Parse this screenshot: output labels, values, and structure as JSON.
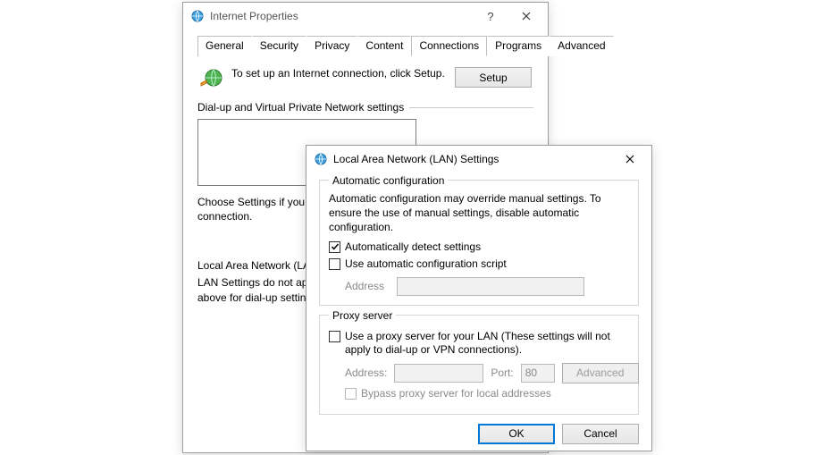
{
  "parent": {
    "title": "Internet Properties",
    "tabs": [
      "General",
      "Security",
      "Privacy",
      "Content",
      "Connections",
      "Programs",
      "Advanced"
    ],
    "active_tab_index": 4,
    "setup_text": "To set up an Internet connection, click Setup.",
    "setup_button": "Setup",
    "dialup_heading": "Dial-up and Virtual Private Network settings",
    "choose_text": "Choose Settings if you need to configure a proxy server for a connection.",
    "lan_heading": "Local Area Network (LAN) settings",
    "lan_text": "LAN Settings do not apply to dial-up connections. Choose Settings above for dial-up settings."
  },
  "lan": {
    "title": "Local Area Network (LAN) Settings",
    "auto": {
      "legend": "Automatic configuration",
      "desc": "Automatic configuration may override manual settings.  To ensure the use of manual settings, disable automatic configuration.",
      "detect_label": "Automatically detect settings",
      "detect_checked": true,
      "script_label": "Use automatic configuration script",
      "script_checked": false,
      "address_label": "Address",
      "address_value": ""
    },
    "proxy": {
      "legend": "Proxy server",
      "use_label": "Use a proxy server for your LAN (These settings will not apply to dial-up or VPN connections).",
      "use_checked": false,
      "address_label": "Address:",
      "address_value": "",
      "port_label": "Port:",
      "port_value": "80",
      "advanced_button": "Advanced",
      "bypass_label": "Bypass proxy server for local addresses",
      "bypass_checked": false
    },
    "ok": "OK",
    "cancel": "Cancel"
  }
}
